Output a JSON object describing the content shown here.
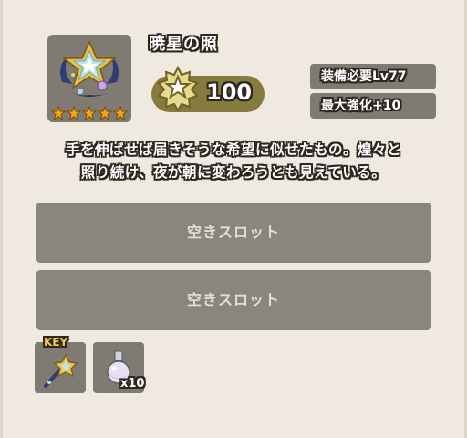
{
  "item": {
    "name": "暁星の照",
    "icon": "star-crest-artifact-icon",
    "rarity_stars": 5,
    "power": "100",
    "power_icon": "star-rank-badge-icon"
  },
  "requirements": {
    "level": "装備必要Lv77",
    "max_enhance": "最大強化+10"
  },
  "description": {
    "line1": "手を伸ばせば届きそうな希望に似せたもの。煌々と",
    "line2": "照り続け、夜が朝に変わろうとも見えている。"
  },
  "slots": [
    {
      "label": "空きスロット"
    },
    {
      "label": "空きスロット"
    }
  ],
  "materials": [
    {
      "tag": "KEY",
      "icon": "star-key-icon"
    },
    {
      "count": "x10",
      "icon": "potion-flask-icon"
    }
  ],
  "colors": {
    "background": "#efe9e0",
    "panel": "#7f7a72",
    "power_pill": "#857b3e",
    "star": "#f2a51a",
    "key_tag": "#f5c542"
  }
}
